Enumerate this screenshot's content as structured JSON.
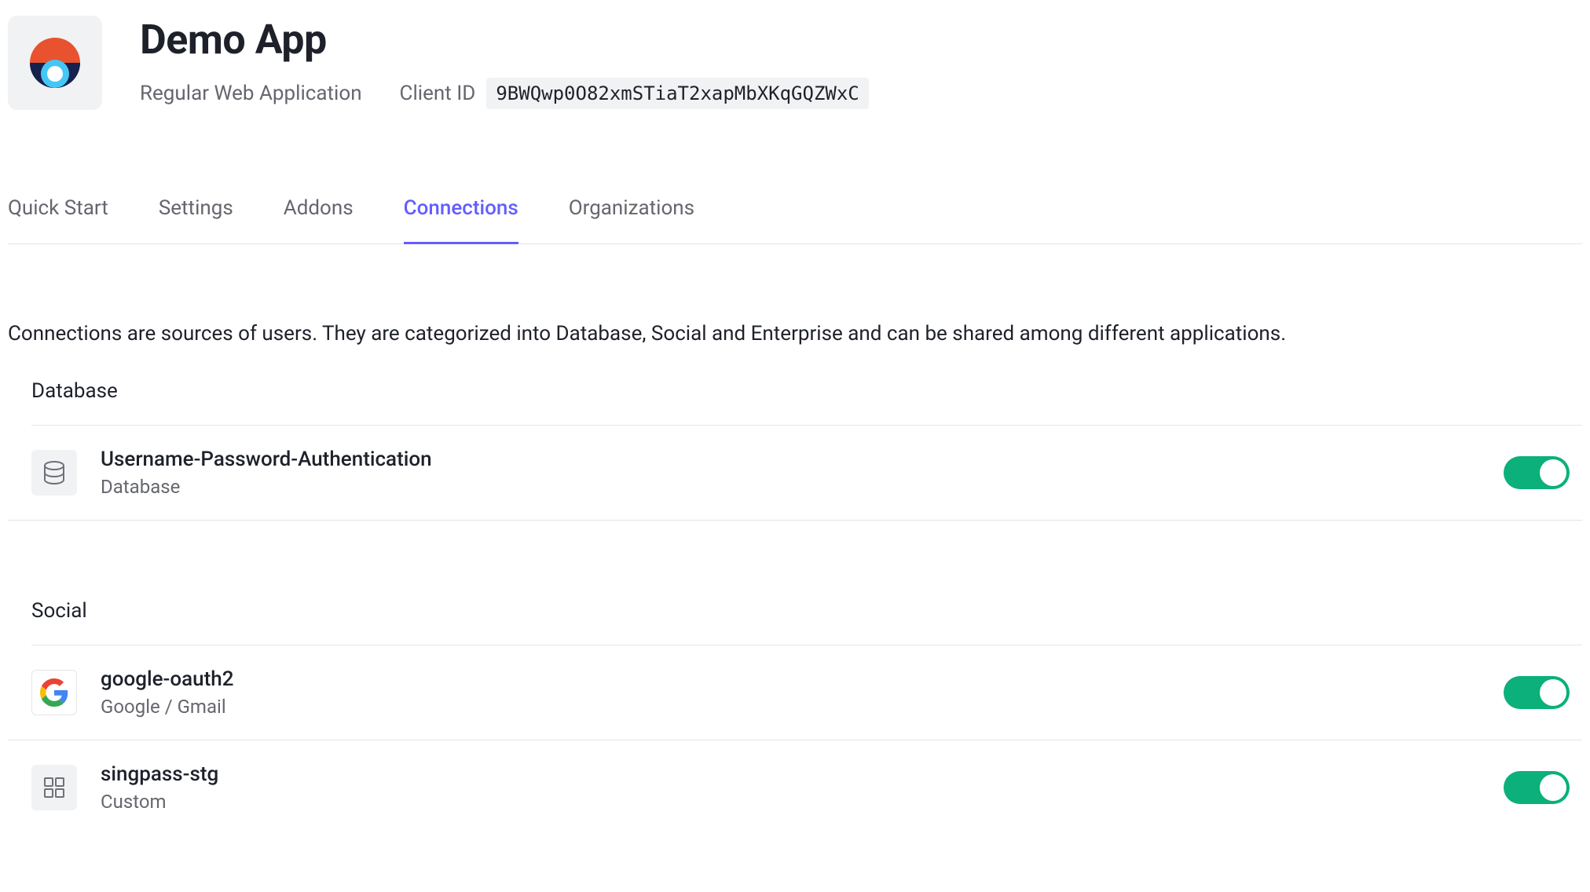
{
  "header": {
    "title": "Demo App",
    "app_type": "Regular Web Application",
    "client_id_label": "Client ID",
    "client_id_value": "9BWQwp0O82xmSTiaT2xapMbXKqGQZWxC"
  },
  "tabs": [
    {
      "label": "Quick Start",
      "active": false
    },
    {
      "label": "Settings",
      "active": false
    },
    {
      "label": "Addons",
      "active": false
    },
    {
      "label": "Connections",
      "active": true
    },
    {
      "label": "Organizations",
      "active": false
    }
  ],
  "description": "Connections are sources of users. They are categorized into Database, Social and Enterprise and can be shared among different applications.",
  "sections": {
    "database": {
      "heading": "Database",
      "items": [
        {
          "title": "Username-Password-Authentication",
          "subtitle": "Database",
          "enabled": true,
          "icon": "database"
        }
      ]
    },
    "social": {
      "heading": "Social",
      "items": [
        {
          "title": "google-oauth2",
          "subtitle": "Google / Gmail",
          "enabled": true,
          "icon": "google"
        },
        {
          "title": "singpass-stg",
          "subtitle": "Custom",
          "enabled": true,
          "icon": "grid"
        }
      ]
    }
  },
  "colors": {
    "accent": "#635dff",
    "toggle_on": "#0bb07b"
  }
}
